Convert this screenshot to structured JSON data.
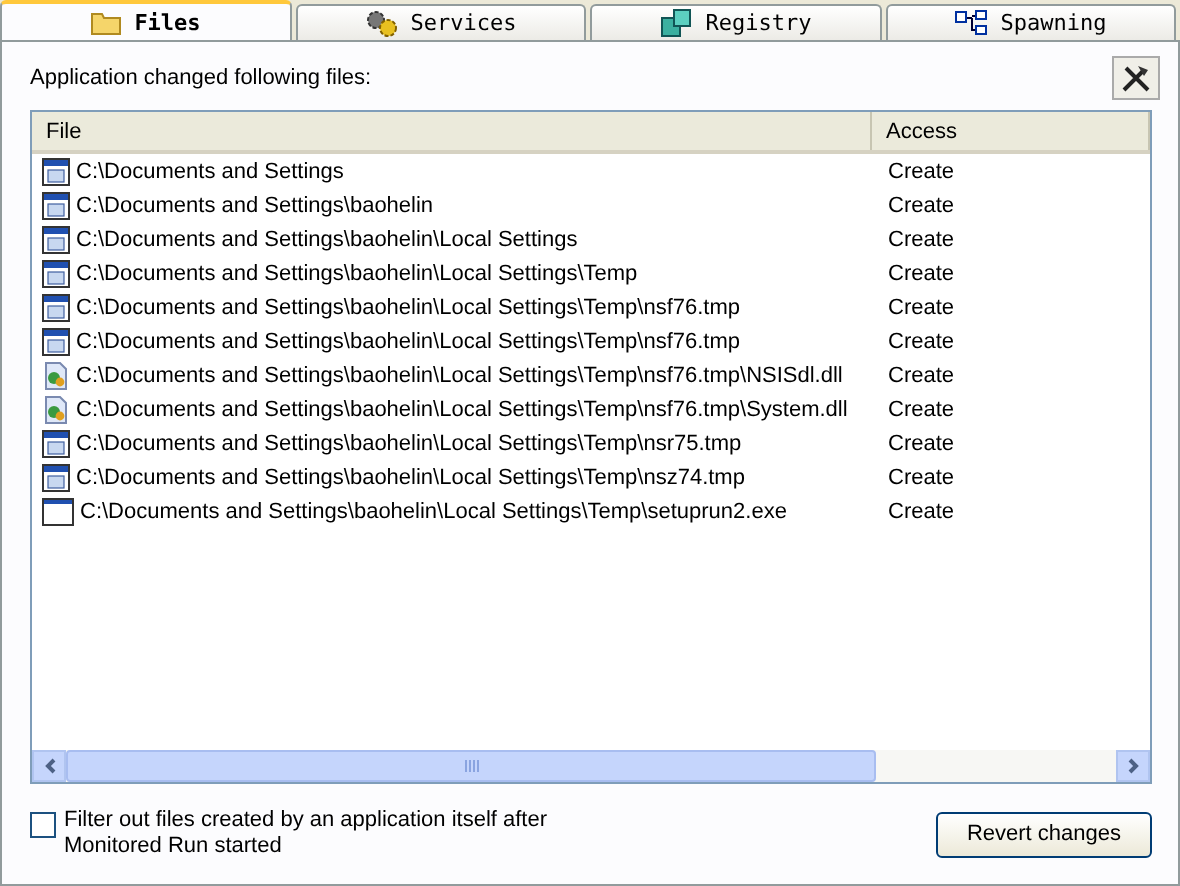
{
  "tabs": [
    {
      "label": "Files",
      "kind": "folder",
      "selected": true
    },
    {
      "label": "Services",
      "kind": "gears",
      "selected": false
    },
    {
      "label": "Registry",
      "kind": "registry",
      "selected": false
    },
    {
      "label": "Spawning",
      "kind": "tree",
      "selected": false
    }
  ],
  "caption": "Application changed following files:",
  "table": {
    "columns": [
      "File",
      "Access"
    ],
    "rows": [
      {
        "kind": "dir",
        "file": "C:\\Documents and Settings",
        "access": "Create"
      },
      {
        "kind": "dir",
        "file": "C:\\Documents and Settings\\baohelin",
        "access": "Create"
      },
      {
        "kind": "dir",
        "file": "C:\\Documents and Settings\\baohelin\\Local Settings",
        "access": "Create"
      },
      {
        "kind": "dir",
        "file": "C:\\Documents and Settings\\baohelin\\Local Settings\\Temp",
        "access": "Create"
      },
      {
        "kind": "dir",
        "file": "C:\\Documents and Settings\\baohelin\\Local Settings\\Temp\\nsf76.tmp",
        "access": "Create"
      },
      {
        "kind": "dir",
        "file": "C:\\Documents and Settings\\baohelin\\Local Settings\\Temp\\nsf76.tmp",
        "access": "Create"
      },
      {
        "kind": "dll",
        "file": "C:\\Documents and Settings\\baohelin\\Local Settings\\Temp\\nsf76.tmp\\NSISdl.dll",
        "access": "Create"
      },
      {
        "kind": "dll",
        "file": "C:\\Documents and Settings\\baohelin\\Local Settings\\Temp\\nsf76.tmp\\System.dll",
        "access": "Create"
      },
      {
        "kind": "dir",
        "file": "C:\\Documents and Settings\\baohelin\\Local Settings\\Temp\\nsr75.tmp",
        "access": "Create"
      },
      {
        "kind": "dir",
        "file": "C:\\Documents and Settings\\baohelin\\Local Settings\\Temp\\nsz74.tmp",
        "access": "Create"
      },
      {
        "kind": "exe",
        "file": "C:\\Documents and Settings\\baohelin\\Local Settings\\Temp\\setuprun2.exe",
        "access": "Create"
      }
    ]
  },
  "filter": {
    "label": "Filter out files created by an application itself after Monitored Run started",
    "checked": false
  },
  "revert_button": "Revert changes"
}
